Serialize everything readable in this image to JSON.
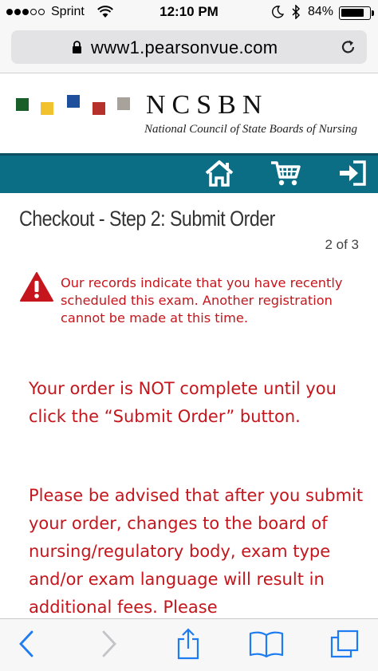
{
  "status_bar": {
    "carrier": "Sprint",
    "time": "12:10 PM",
    "battery": "84%",
    "signal_bars_filled": 3,
    "signal_bars_total": 5
  },
  "browser": {
    "url": "www1.pearsonvue.com"
  },
  "header": {
    "brand": "NCSBN",
    "tagline": "National Council of State Boards of Nursing",
    "logo_colors": [
      "#1a5e2a",
      "#f2c12e",
      "#1d4f9c",
      "#b6312c",
      "#a7a39c"
    ]
  },
  "nav": {
    "icons": [
      "home-icon",
      "shopping-cart-icon",
      "sign-out-icon"
    ]
  },
  "checkout": {
    "title": "Checkout - Step 2: Submit Order",
    "step": "2 of 3",
    "alert_message": "Our records indicate that you have recently scheduled this exam. Another registration cannot be made at this time.",
    "notice_incomplete": "Your order is NOT complete until you click the “Submit Order” button.",
    "notice_fees": "Please be advised that after you submit your order, changes to the board of nursing/regulatory body, exam type and/or exam language will result in additional fees. Please"
  },
  "theme": {
    "nav_color": "#0c6e84",
    "alert_color": "#c4161c",
    "ios_blue": "#1e7cf2"
  }
}
